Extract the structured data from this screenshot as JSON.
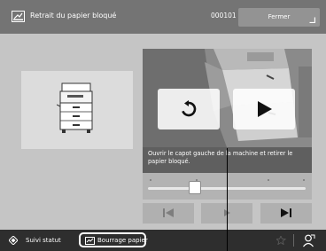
{
  "header": {
    "title": "Retrait du papier bloqué",
    "code": "000101",
    "close_label": "Fermer"
  },
  "video": {
    "caption": "Ouvrir le capot gauche de la machine et retirer le papier bloqué."
  },
  "playback": {
    "position": 0.3,
    "chapters": 4
  },
  "status": {
    "monitor_label": "Suivi statut",
    "alert_label": "Bourrage papier"
  },
  "icons": {
    "header": "paper-jam-icon",
    "close": "corner-arrow-icon",
    "replay": "replay-icon",
    "play": "play-icon",
    "prev": "skip-previous-icon",
    "next": "skip-next-icon",
    "status": "status-monitor-icon",
    "alert": "paper-jam-icon",
    "favorite": "favorite-icon",
    "user": "user-icon"
  },
  "colors": {
    "header_bg": "#747474",
    "status_bg": "#2e2e2e"
  }
}
